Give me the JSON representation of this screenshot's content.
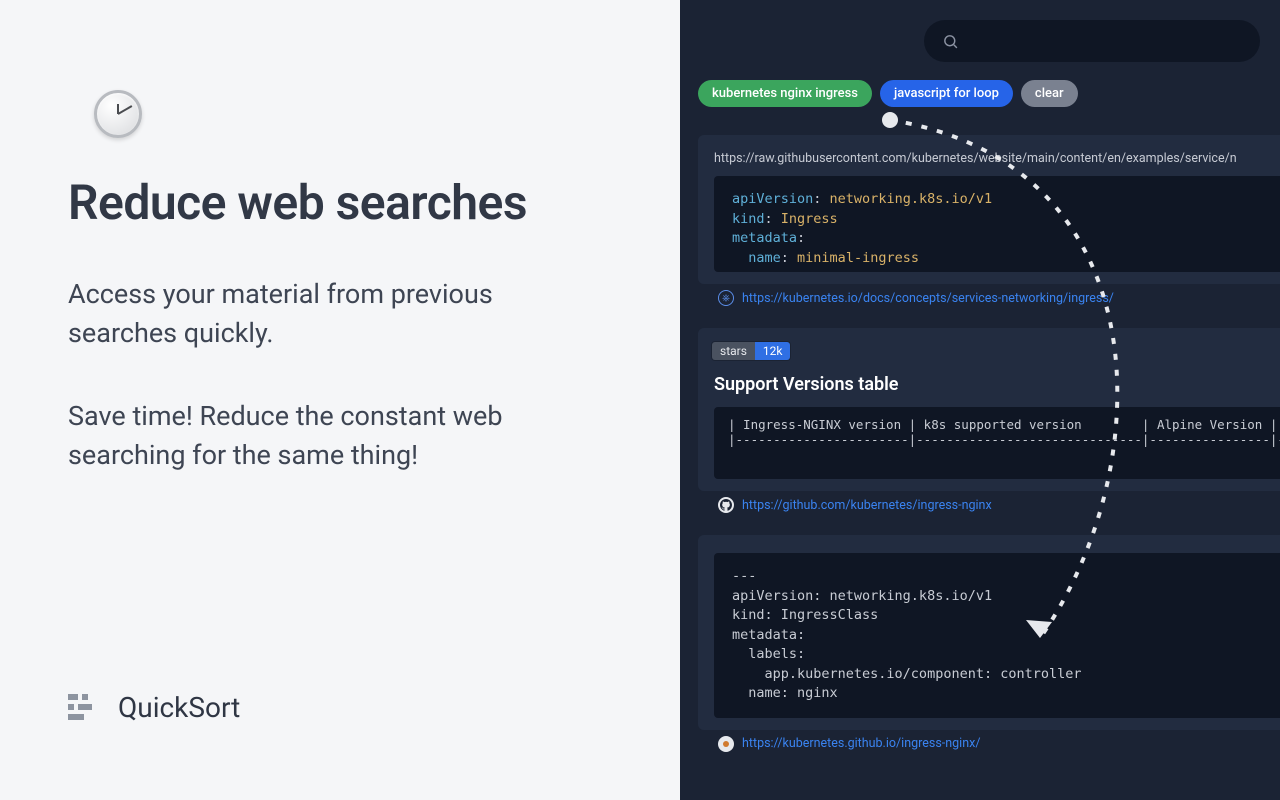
{
  "left": {
    "headline": "Reduce web searches",
    "paragraph1": "Access your material from previous searches quickly.",
    "paragraph2": "Save time! Reduce the constant web searching for the same thing!"
  },
  "brand": {
    "name": "QuickSort"
  },
  "search": {
    "placeholder": ""
  },
  "chips": [
    {
      "label": "kubernetes nginx ingress",
      "variant": "green"
    },
    {
      "label": "javascript for loop",
      "variant": "blue"
    },
    {
      "label": "clear",
      "variant": "gray"
    }
  ],
  "cards": [
    {
      "header_url": "https://raw.githubusercontent.com/kubernetes/website/main/content/en/examples/service/n",
      "code_lines": [
        {
          "key": "apiVersion",
          "value": "networking.k8s.io/v1"
        },
        {
          "key": "kind",
          "value": "Ingress"
        },
        {
          "key": "metadata",
          "value": ""
        },
        {
          "key": "  name",
          "value": "minimal-ingress"
        }
      ],
      "link": "https://kubernetes.io/docs/concepts/services-networking/ingress/",
      "favicon": "k8s"
    },
    {
      "badge": {
        "left": "stars",
        "right": "12k"
      },
      "title": "Support Versions table",
      "table_text": "| Ingress-NGINX version | k8s supported version        | Alpine Version | Nginx Versi\n|-----------------------|------------------------------|----------------|------------",
      "link": "https://github.com/kubernetes/ingress-nginx",
      "favicon": "gh"
    },
    {
      "code_text": "---\napiVersion: networking.k8s.io/v1\nkind: IngressClass\nmetadata:\n  labels:\n    app.kubernetes.io/component: controller\n  name: nginx",
      "link": "https://kubernetes.github.io/ingress-nginx/",
      "favicon": "dot"
    }
  ]
}
